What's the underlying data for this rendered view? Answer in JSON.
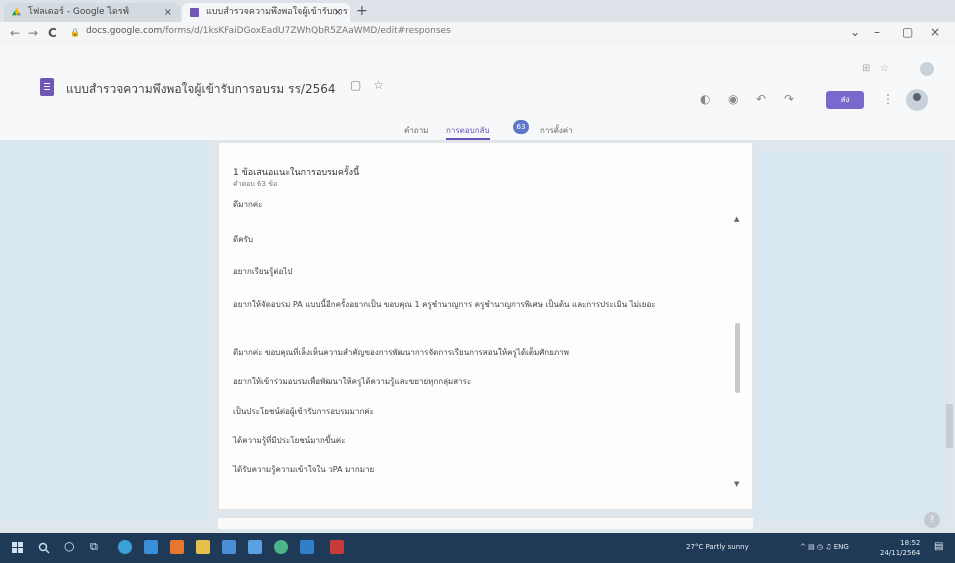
{
  "browser": {
    "tabs": [
      {
        "title": "โฟลเดอร์ - Google ไดรฟ์",
        "close": "×"
      },
      {
        "title": "แบบสำรวจความพึงพอใจผู้เข้ารับการ",
        "close": "×"
      }
    ],
    "new_tab": "+",
    "nav": {
      "back": "←",
      "forward": "→",
      "reload": "C"
    },
    "url": {
      "host": "docs.google.com",
      "path": "/forms/d/1ksKFaiDGoxEadU7ZWhQbR5ZAaWMD/edit#responses"
    },
    "window": {
      "minimize": "–",
      "maximize": "▢",
      "close": "×"
    }
  },
  "header": {
    "title": "แบบสำรวจความพึงพอใจผู้เข้ารับการอบรม รร/2564",
    "folder_icon": "▢",
    "star_icon": "☆",
    "send_label": "ส่ง",
    "more_icon": "⋮",
    "toolbar_icons": [
      "◐",
      "◉",
      "↶",
      "↷"
    ],
    "ext_icons": [
      "⊞",
      "☆"
    ]
  },
  "form_tabs": [
    {
      "label": "คำถาม",
      "active": false
    },
    {
      "label": "การตอบกลับ",
      "active": true
    },
    {
      "label": "การตั้งค่า",
      "active": false
    }
  ],
  "responses_badge": "63",
  "question": {
    "title": "1 ข้อเสนอแนะในการอบรมครั้งนี้",
    "subtitle": "คำตอบ 63 ข้อ",
    "responses": [
      "ดีมากค่ะ",
      "ดีครับ",
      "อยากเรียนรู้ต่อไป",
      "อยากให้จัดอบรม PA แบบนี้อีกครั้งอยากเป็น ขอบคุณ 1 ครูชำนาญการ ครูชำนาญการพิเศษ เป็นต้น และการประเมิน ไม่เยอะ",
      "ดีมากค่ะ ขอบคุณที่เล็งเห็นความสำคัญของการพัฒนาการจัดการเรียนการสอนให้ครูได้เต็มศักยภาพ",
      "อยากให้เข้าร่วมอบรมเพื่อพัฒนาให้ครูได้ความรู้และขยายทุกกลุ่มสาระ",
      "เป็นประโยชน์ต่อผู้เข้ารับการอบรมมากค่ะ",
      "ได้ความรู้ที่มีประโยชน์มากขึ้นค่ะ",
      "ได้รับความรู้ความเข้าใจใน วPA มากมาย"
    ]
  },
  "scrollbar": {
    "up": "▲",
    "down": "▼"
  },
  "help": "?",
  "taskbar": {
    "weather": "27°C Partly sunny",
    "tray_icons": "^ ▤ ◷ ♫ ENG",
    "time": "18:52",
    "date": "24/11/2564"
  },
  "colors": {
    "accent": "#6a54b8",
    "send_button": "#7a68cf",
    "taskbar": "#1f3a57",
    "side_panel": "#d8e6f0"
  }
}
